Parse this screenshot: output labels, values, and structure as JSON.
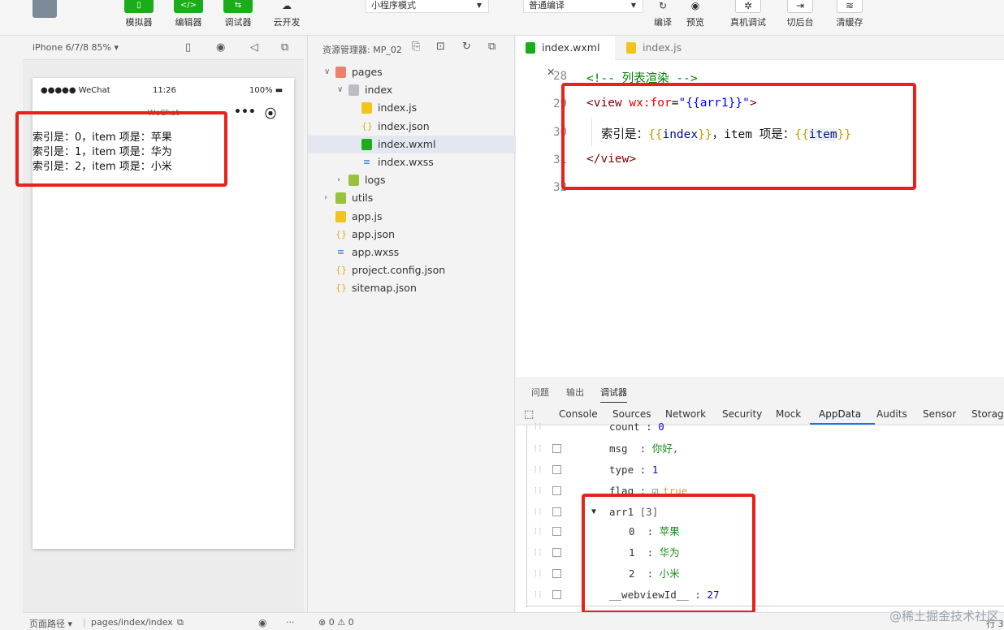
{
  "toolbar": {
    "buttons": [
      {
        "label": "模拟器",
        "glyph": "▯"
      },
      {
        "label": "编辑器",
        "glyph": "</>"
      },
      {
        "label": "调试器",
        "glyph": "⇆"
      },
      {
        "label": "云开发",
        "glyph": "☁"
      }
    ],
    "mode_select": "小程序模式",
    "compile_select": "普通编译",
    "actions": [
      {
        "label": "编译",
        "glyph": "↻"
      },
      {
        "label": "预览",
        "glyph": "◉"
      },
      {
        "label": "真机调试",
        "glyph": "✲"
      },
      {
        "label": "切后台",
        "glyph": "⇥"
      },
      {
        "label": "清缓存",
        "glyph": "≋"
      }
    ]
  },
  "simulator": {
    "device": "iPhone 6/7/8 85% ▾",
    "status_left": "●●●●● WeChat",
    "status_time": "11:26",
    "status_right": "100%",
    "nav_title": "WeChat",
    "capsule_more": "•••",
    "capsule_close": "⦿",
    "lines": [
      "索引是：0，item 项是：苹果",
      "索引是：1，item 项是：华为",
      "索引是：2，item 项是：小米"
    ]
  },
  "explorer": {
    "title": "资源管理器: MP_02",
    "tree": [
      {
        "name": "pages",
        "indent": 0,
        "chev": "∨",
        "icon": "folder-red"
      },
      {
        "name": "index",
        "indent": 1,
        "chev": "∨",
        "icon": "folder"
      },
      {
        "name": "index.js",
        "indent": 2,
        "chev": "",
        "icon": "js"
      },
      {
        "name": "index.json",
        "indent": 2,
        "chev": "",
        "icon": "json"
      },
      {
        "name": "index.wxml",
        "indent": 2,
        "chev": "",
        "icon": "wxml",
        "selected": true
      },
      {
        "name": "index.wxss",
        "indent": 2,
        "chev": "",
        "icon": "wxss"
      },
      {
        "name": "logs",
        "indent": 1,
        "chev": "›",
        "icon": "folder-green"
      },
      {
        "name": "utils",
        "indent": 0,
        "chev": "›",
        "icon": "folder-green"
      },
      {
        "name": "app.js",
        "indent": 0,
        "chev": "",
        "icon": "js"
      },
      {
        "name": "app.json",
        "indent": 0,
        "chev": "",
        "icon": "json"
      },
      {
        "name": "app.wxss",
        "indent": 0,
        "chev": "",
        "icon": "wxss"
      },
      {
        "name": "project.config.json",
        "indent": 0,
        "chev": "",
        "icon": "json"
      },
      {
        "name": "sitemap.json",
        "indent": 0,
        "chev": "",
        "icon": "json"
      }
    ]
  },
  "editor": {
    "tabs": [
      {
        "label": "index.wxml",
        "close": "✕",
        "active": true
      },
      {
        "label": "index.js",
        "active": false
      }
    ],
    "line_numbers": [
      "28",
      "29",
      "30",
      "31",
      "32"
    ],
    "code": {
      "l28": "<!-- 列表渲染 -->",
      "l29_open": "<view ",
      "l29_attr": "wx:for",
      "l29_eq": "=",
      "l29_str": "\"{{arr1}}\"",
      "l29_close": ">",
      "l30_a": "索引是：",
      "l30_b1": "{{",
      "l30_v1": "index",
      "l30_b2": "}}",
      "l30_c": "，item 项是：",
      "l30_b3": "{{",
      "l30_v2": "item",
      "l30_b4": "}}",
      "l31": "</view>"
    }
  },
  "debugger": {
    "top_tabs": [
      "问题",
      "输出",
      "调试器"
    ],
    "dev_tabs": [
      "Console",
      "Sources",
      "Network",
      "Security",
      "Mock",
      "AppData",
      "Audits",
      "Sensor",
      "Storage"
    ],
    "active_dev_tab": "AppData",
    "rows": [
      {
        "key": "count",
        "sep": " : ",
        "val": "0",
        "type": "num"
      },
      {
        "key": "msg",
        "sep": "  : ",
        "val": "你好,",
        "type": "str"
      },
      {
        "key": "type",
        "sep": " : ",
        "val": "1",
        "type": "num"
      },
      {
        "key": "flag",
        "sep": " : ",
        "val": "true",
        "type": "bool"
      },
      {
        "key": "arr1",
        "sep": " ",
        "val": "[3]",
        "type": "arr"
      },
      {
        "key": "0",
        "sep": "  : ",
        "val": "苹果",
        "type": "str"
      },
      {
        "key": "1",
        "sep": "  : ",
        "val": "华为",
        "type": "str"
      },
      {
        "key": "2",
        "sep": "  : ",
        "val": "小米",
        "type": "str"
      },
      {
        "key": "__webviewId__",
        "sep": " : ",
        "val": "27",
        "type": "num"
      }
    ]
  },
  "statusbar": {
    "path_label": "页面路径 ▾",
    "path": "pages/index/index",
    "errors": "⊗ 0 ⚠ 0",
    "eye": "◉",
    "more": "···",
    "line": "行 3"
  },
  "watermark": "@稀土掘金技术社区",
  "colors": {
    "accent": "#1aad19",
    "highlight": "#e8211b",
    "link": "#1a73e8"
  }
}
